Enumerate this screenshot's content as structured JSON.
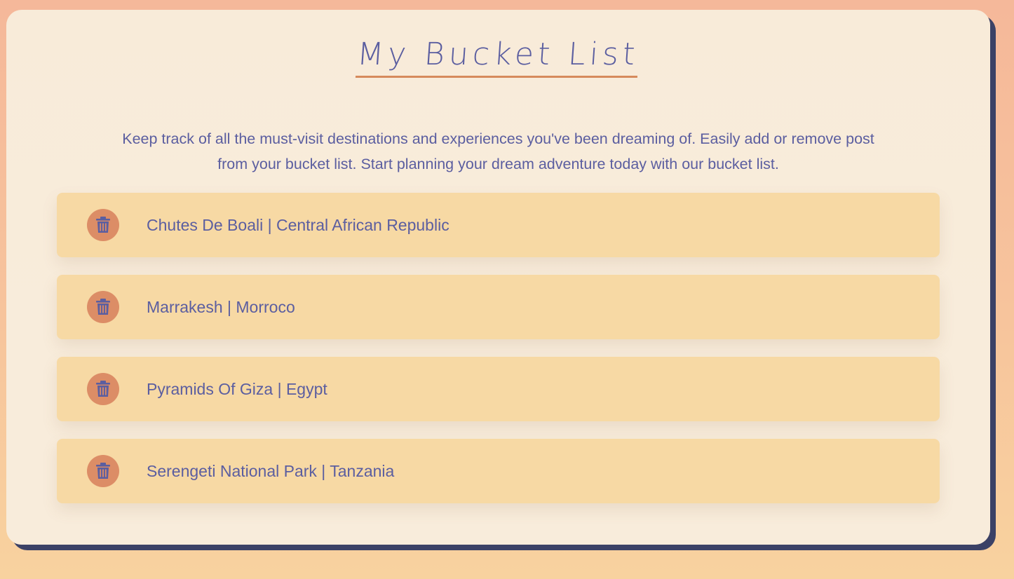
{
  "page": {
    "title": "My Bucket List",
    "description": "Keep track of all the must-visit destinations and experiences you've been dreaming of. Easily add or remove post from your bucket list. Start planning your dream adventure today with our bucket list."
  },
  "items": [
    {
      "label": "Chutes De Boali | Central African Republic",
      "icon": "trash-icon"
    },
    {
      "label": "Marrakesh | Morroco",
      "icon": "trash-icon"
    },
    {
      "label": "Pyramids Of Giza | Egypt",
      "icon": "trash-icon"
    },
    {
      "label": "Serengeti National Park | Tanzania",
      "icon": "trash-icon"
    }
  ],
  "colors": {
    "text": "#5b5ea0",
    "accent": "#d68a5c",
    "item_background": "#f7d9a4",
    "card_background": "#f8ecdb",
    "card_shadow": "#3b4166"
  }
}
